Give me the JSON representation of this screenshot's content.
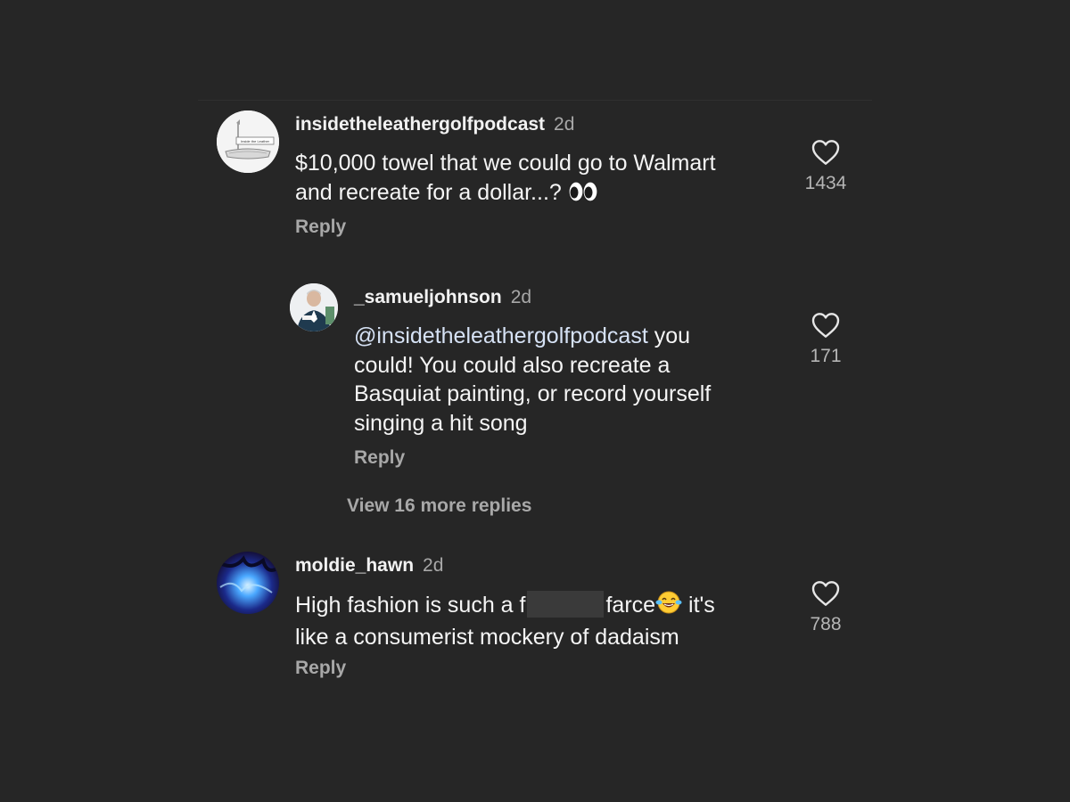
{
  "comments": [
    {
      "username": "insidetheleathergolfpodcast",
      "time": "2d",
      "text_line1": "$10,000 towel that we could go to Walmart",
      "text_line2": "and recreate for a dollar...?",
      "likes": "1434",
      "reply_label": "Reply",
      "avatar_text": "Inside the Leather"
    },
    {
      "username": "_samueljohnson",
      "time": "2d",
      "mention": "@insidetheleathergolfpodcast",
      "text_line1_rest": " you",
      "text_line2": "could! You could also recreate a",
      "text_line3": "Basquiat painting, or record yourself",
      "text_line4": "singing a hit song",
      "likes": "171",
      "reply_label": "Reply"
    },
    {
      "username": "moldie_hawn",
      "time": "2d",
      "text_part1": "High fashion is such a f",
      "text_part2": "farce",
      "text_part3": " it's",
      "text_line2": "like a consumerist mockery of dadaism",
      "likes": "788",
      "reply_label": "Reply"
    }
  ],
  "view_more_label": "View 16 more replies",
  "icons": {
    "like": "heart-outline-icon",
    "eyes": "eyes-emoji",
    "laugh": "tears-of-joy-emoji"
  },
  "colors": {
    "background": "#262626",
    "username": "#f2f2f2",
    "secondary": "#a8a8a8",
    "mention": "#d6e2f5"
  }
}
